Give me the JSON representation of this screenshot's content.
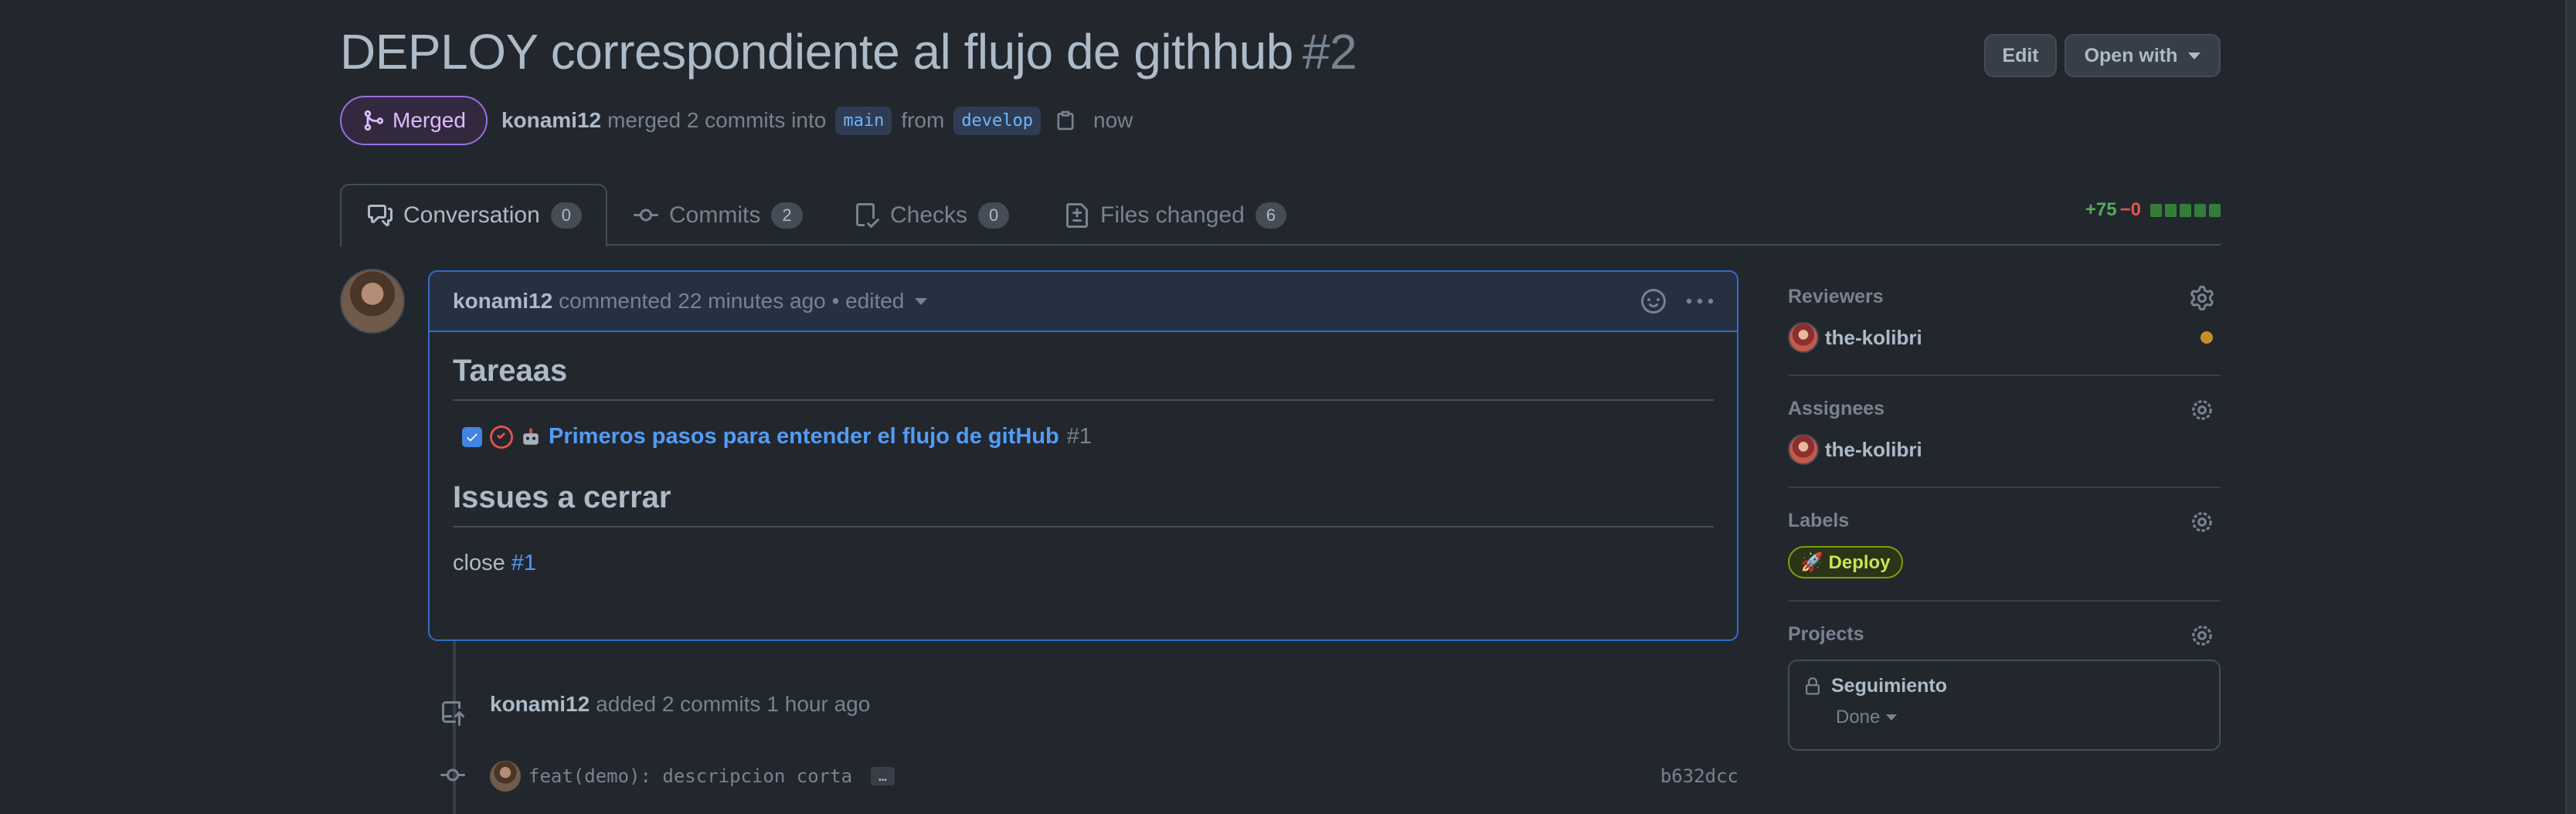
{
  "pr": {
    "title": "DEPLOY correspondiente al flujo de githhub",
    "number": "#2",
    "edit_label": "Edit",
    "open_with_label": "Open with",
    "state": "Merged",
    "author": "konami12",
    "merged_text": "merged 2 commits into",
    "base_branch": "main",
    "from_text": "from",
    "head_branch": "develop",
    "time": "now"
  },
  "tabs": [
    {
      "label": "Conversation",
      "count": "0",
      "icon": "conversation-icon"
    },
    {
      "label": "Commits",
      "count": "2",
      "icon": "commit-icon"
    },
    {
      "label": "Checks",
      "count": "0",
      "icon": "checks-icon"
    },
    {
      "label": "Files changed",
      "count": "6",
      "icon": "file-diff-icon"
    }
  ],
  "diffstat": {
    "additions": "+75",
    "deletions": "−0"
  },
  "comment": {
    "author": "konami12",
    "action": "commented",
    "time": "22 minutes ago",
    "edited": "• edited",
    "heading1": "Tareaas",
    "task_title": "Primeros pasos para entender el flujo de gitHub",
    "task_number": "#1",
    "heading2": "Issues a cerrar",
    "close_text": "close",
    "close_ref": "#1"
  },
  "event": {
    "author": "konami12",
    "action": "added 2 commits",
    "time": "1 hour ago"
  },
  "commit": {
    "message": "feat(demo): descripcion corta",
    "more": "…",
    "sha": "b632dcc"
  },
  "sidebar": {
    "reviewers_title": "Reviewers",
    "reviewer": "the-kolibri",
    "assignees_title": "Assignees",
    "assignee": "the-kolibri",
    "labels_title": "Labels",
    "label": "🚀 Deploy",
    "label_color": "#c4e554",
    "projects_title": "Projects",
    "project_name": "Seguimiento",
    "project_status": "Done"
  },
  "colors": {
    "accent": "#316dca",
    "merged": "#986ee2",
    "pending": "#c69026"
  }
}
